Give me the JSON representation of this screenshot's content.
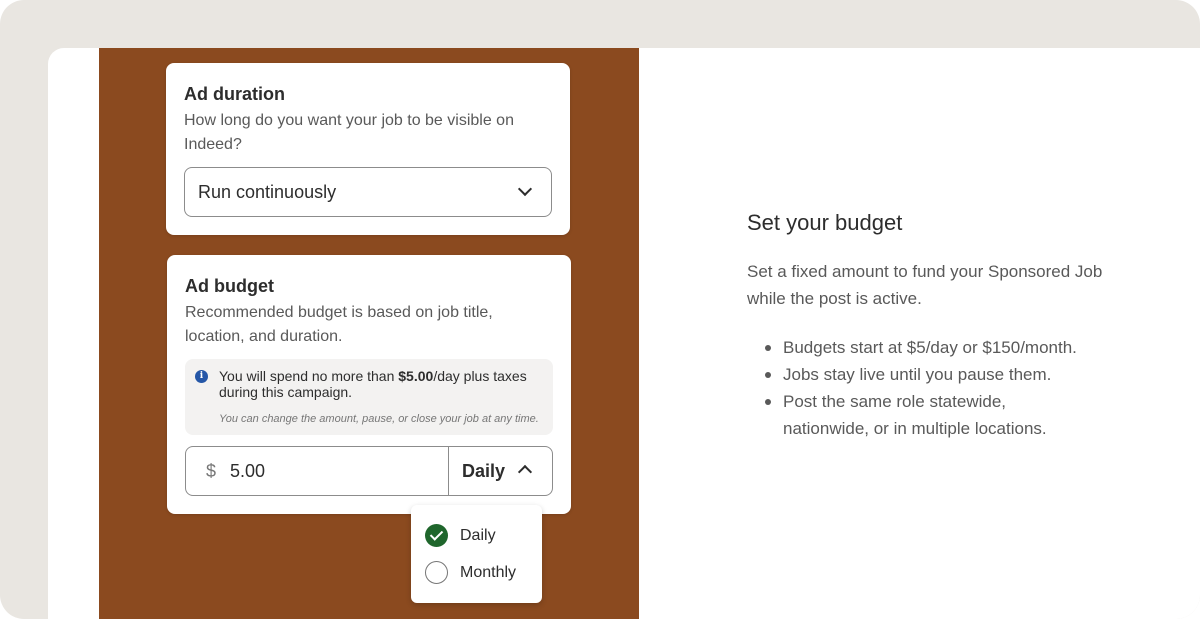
{
  "ad_duration": {
    "title": "Ad duration",
    "description": "How long do you want your job to be visible on Indeed?",
    "selected": "Run continuously"
  },
  "ad_budget": {
    "title": "Ad budget",
    "description": "Recommended budget is based on job title, location, and duration.",
    "notice": {
      "prefix": "You will spend no more than ",
      "amount": "$5.00",
      "suffix": "/day plus taxes during this campaign.",
      "small": "You can change the amount, pause, or close your job at any time."
    },
    "currency_symbol": "$",
    "amount_value": "5.00",
    "period": "Daily",
    "options": [
      {
        "label": "Daily",
        "selected": true
      },
      {
        "label": "Monthly",
        "selected": false
      }
    ]
  },
  "info": {
    "title": "Set your budget",
    "description": "Set a fixed amount to fund your Sponsored Job while the post is active.",
    "bullets": [
      "Budgets start at $5/day or $150/month.",
      "Jobs stay live until you pause them.",
      "Post the same role statewide, nationwide, or in multiple locations."
    ]
  },
  "colors": {
    "brand_brown": "#8b4a1f",
    "success_green": "#1f662c",
    "info_blue": "#2557a7"
  }
}
